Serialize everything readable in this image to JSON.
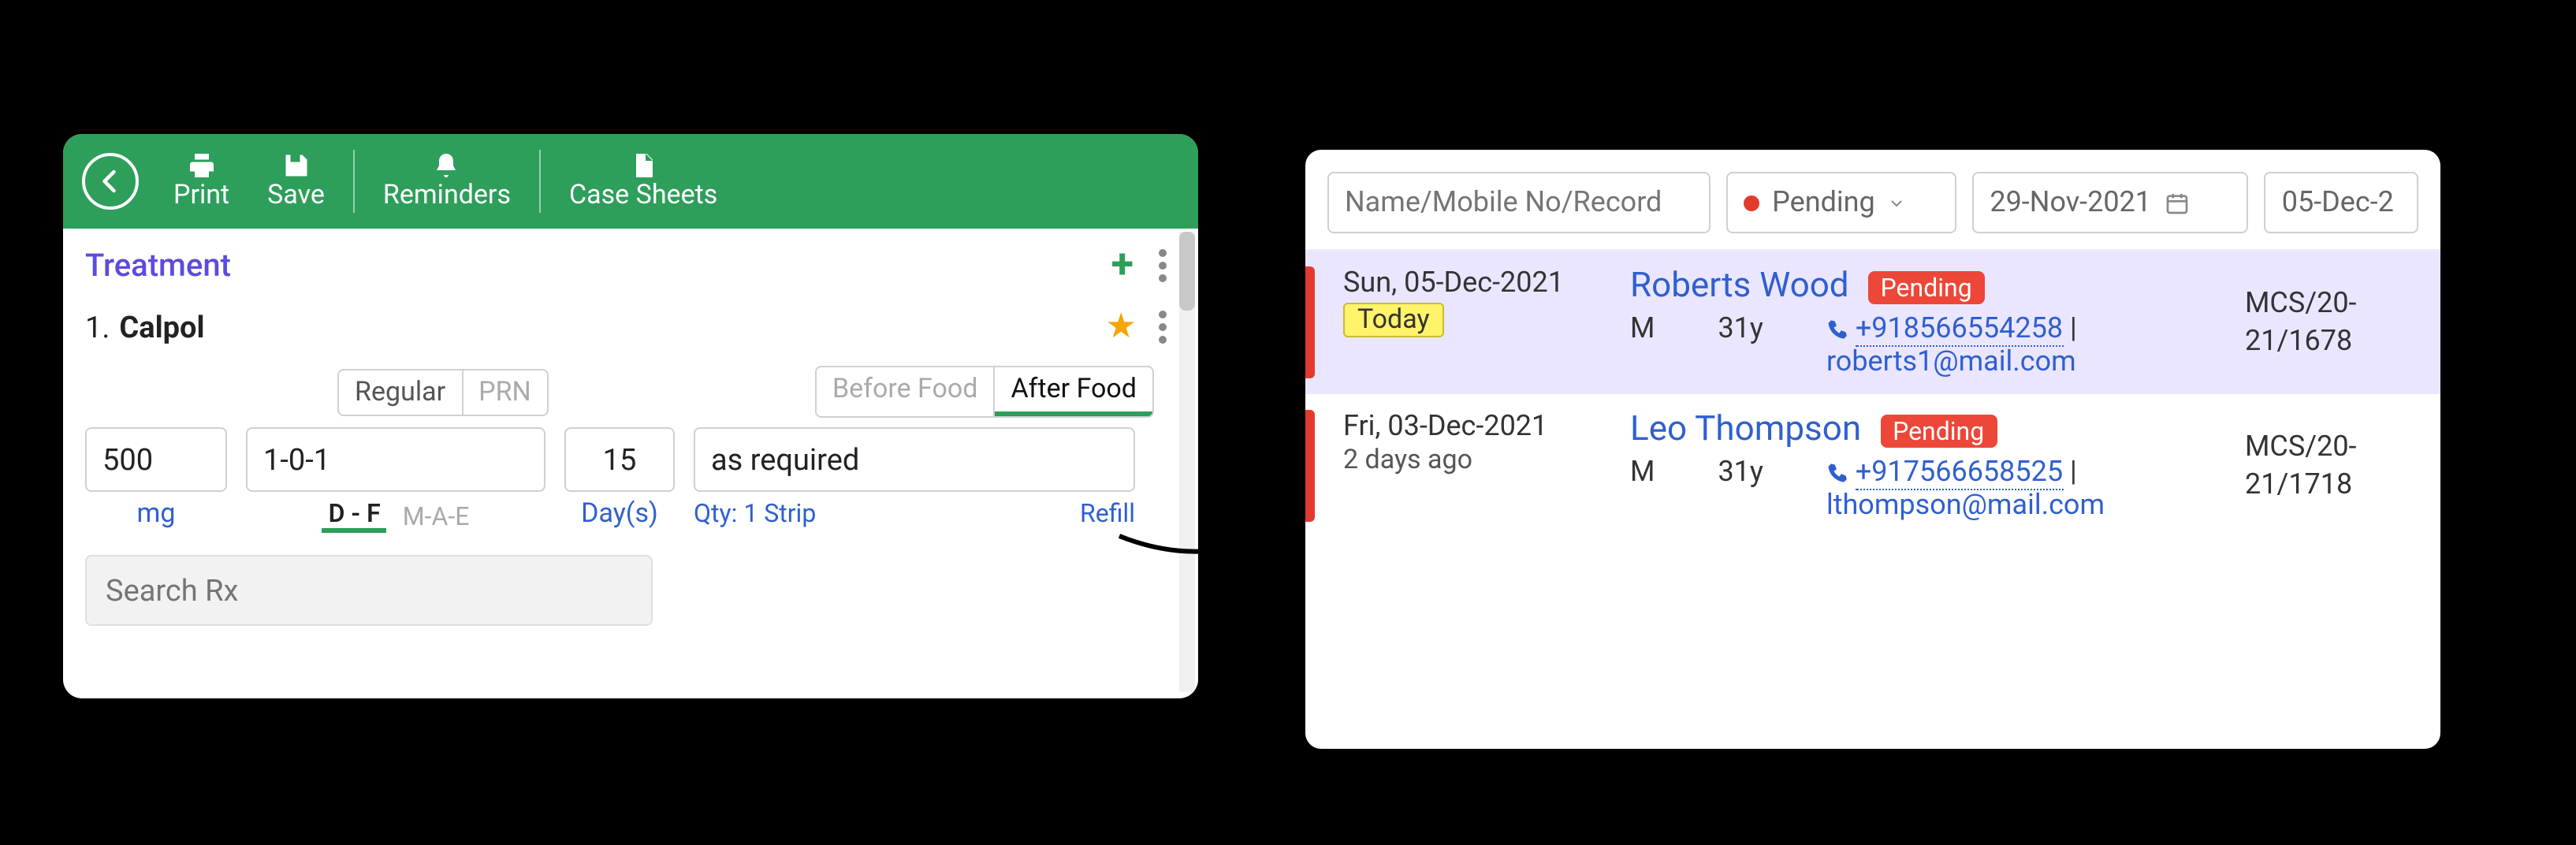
{
  "toolbar": {
    "print": "Print",
    "save": "Save",
    "reminders": "Reminders",
    "case_sheets": "Case Sheets"
  },
  "section": {
    "title": "Treatment"
  },
  "med": {
    "index": "1.",
    "name": "Calpol",
    "type_regular": "Regular",
    "type_prn": "PRN",
    "before_food": "Before Food",
    "after_food": "After Food",
    "dose_value": "500",
    "dose_unit": "mg",
    "freq_value": "1-0-1",
    "freq_df": "D - F",
    "freq_mae": "M-A-E",
    "duration_value": "15",
    "duration_unit": "Day(s)",
    "qty": "Qty: 1 Strip",
    "refill": "Refill",
    "instruction": "as required"
  },
  "search_rx_placeholder": "Search Rx",
  "filters": {
    "search_placeholder": "Name/Mobile No/Record",
    "status": "Pending",
    "date_from": "29-Nov-2021",
    "date_to": "05-Dec-2"
  },
  "records": [
    {
      "date": "Sun, 05-Dec-2021",
      "relative": "Today",
      "relative_is_today": true,
      "name": "Roberts Wood",
      "status": "Pending",
      "gender": "M",
      "age": "31y",
      "phone": "+918566554258",
      "email": "roberts1@mail.com",
      "record_id": "MCS/20-21/1678",
      "selected": true
    },
    {
      "date": "Fri, 03-Dec-2021",
      "relative": "2 days ago",
      "relative_is_today": false,
      "name": "Leo Thompson",
      "status": "Pending",
      "gender": "M",
      "age": "31y",
      "phone": "+917566658525",
      "email": "lthompson@mail.com",
      "record_id": "MCS/20-21/1718",
      "selected": false
    }
  ]
}
